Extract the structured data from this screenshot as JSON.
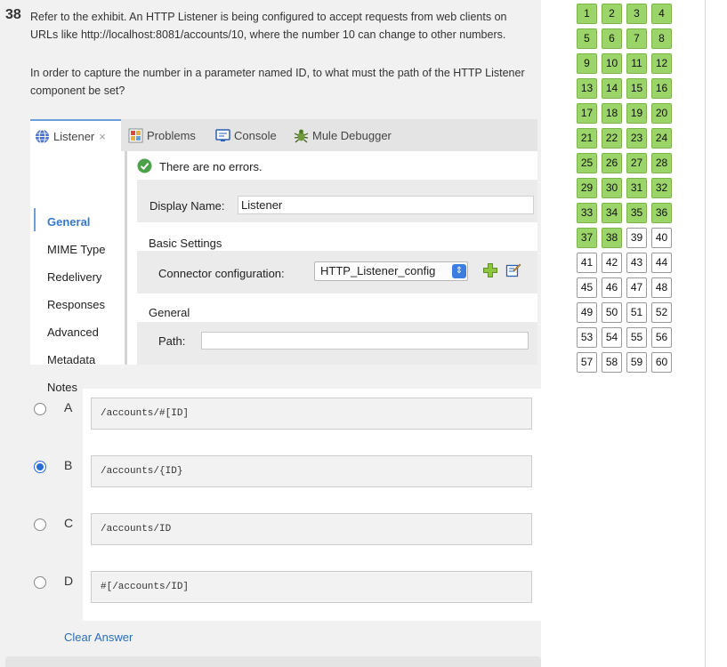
{
  "question": {
    "number": "38",
    "text_line1": "Refer to the exhibit. An HTTP Listener is being configured to accept requests from web clients on URLs like http://localhost:8081/accounts/10, where the number 10 can change to other numbers.",
    "text_line2": "In order to capture the number in a parameter named ID, to what must the path of the HTTP Listener component be set?"
  },
  "exhibit": {
    "tabs": {
      "listener": "Listener",
      "close": "×",
      "problems": "Problems",
      "console": "Console",
      "debugger": "Mule Debugger"
    },
    "sidebar": {
      "general": "General",
      "mime": "MIME Type",
      "redelivery": "Redelivery",
      "responses": "Responses",
      "advanced": "Advanced",
      "metadata": "Metadata",
      "notes": "Notes"
    },
    "status": "There are no errors.",
    "display_name_label": "Display Name:",
    "display_name_value": "Listener",
    "basic_settings_label": "Basic Settings",
    "connector_label": "Connector configuration:",
    "connector_value": "HTTP_Listener_config",
    "general_label": "General",
    "path_label": "Path:",
    "path_value": ""
  },
  "options": [
    {
      "letter": "A",
      "code": "/accounts/#[ID]",
      "selected": false
    },
    {
      "letter": "B",
      "code": "/accounts/{ID}",
      "selected": true
    },
    {
      "letter": "C",
      "code": "/accounts/ID",
      "selected": false
    },
    {
      "letter": "D",
      "code": "#[/accounts/ID]",
      "selected": false
    }
  ],
  "clear_answer": "Clear Answer",
  "grid": {
    "numbers": [
      "1",
      "2",
      "3",
      "4",
      "5",
      "6",
      "7",
      "8",
      "9",
      "10",
      "11",
      "12",
      "13",
      "14",
      "15",
      "16",
      "17",
      "18",
      "19",
      "20",
      "21",
      "22",
      "23",
      "24",
      "25",
      "26",
      "27",
      "28",
      "29",
      "30",
      "31",
      "32",
      "33",
      "34",
      "35",
      "36",
      "37",
      "38",
      "39",
      "40",
      "41",
      "42",
      "43",
      "44",
      "45",
      "46",
      "47",
      "48",
      "49",
      "50",
      "51",
      "52",
      "53",
      "54",
      "55",
      "56",
      "57",
      "58",
      "59",
      "60"
    ],
    "answered_through": 38,
    "answered_color": "#9bd468"
  }
}
